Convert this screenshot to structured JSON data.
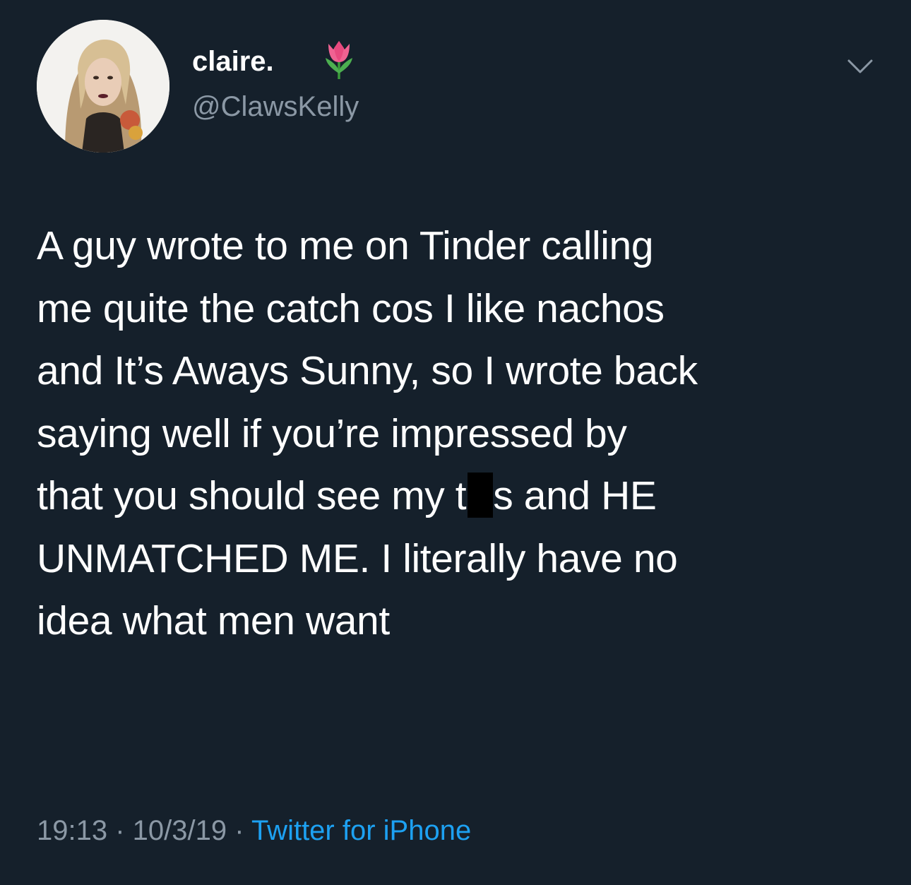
{
  "user": {
    "display_name": "claire.",
    "handle": "@ClawsKelly",
    "name_emoji": "tulip-icon"
  },
  "tweet": {
    "lines": [
      "A guy wrote to me on Tinder calling",
      "me quite the catch cos I like nachos",
      "and It’s Aways Sunny, so I wrote back",
      "saying well if you’re impressed by"
    ],
    "line5_before": "that you should see my t",
    "line5_after": "s and HE",
    "line6": "UNMATCHED ME. I literally have no",
    "line7": "idea what men want"
  },
  "meta": {
    "time": "19:13",
    "separator": " · ",
    "date": "10/3/19",
    "source": "Twitter for iPhone"
  },
  "colors": {
    "background": "#15202b",
    "secondary_text": "#8b98a5",
    "link": "#1da1f2"
  }
}
